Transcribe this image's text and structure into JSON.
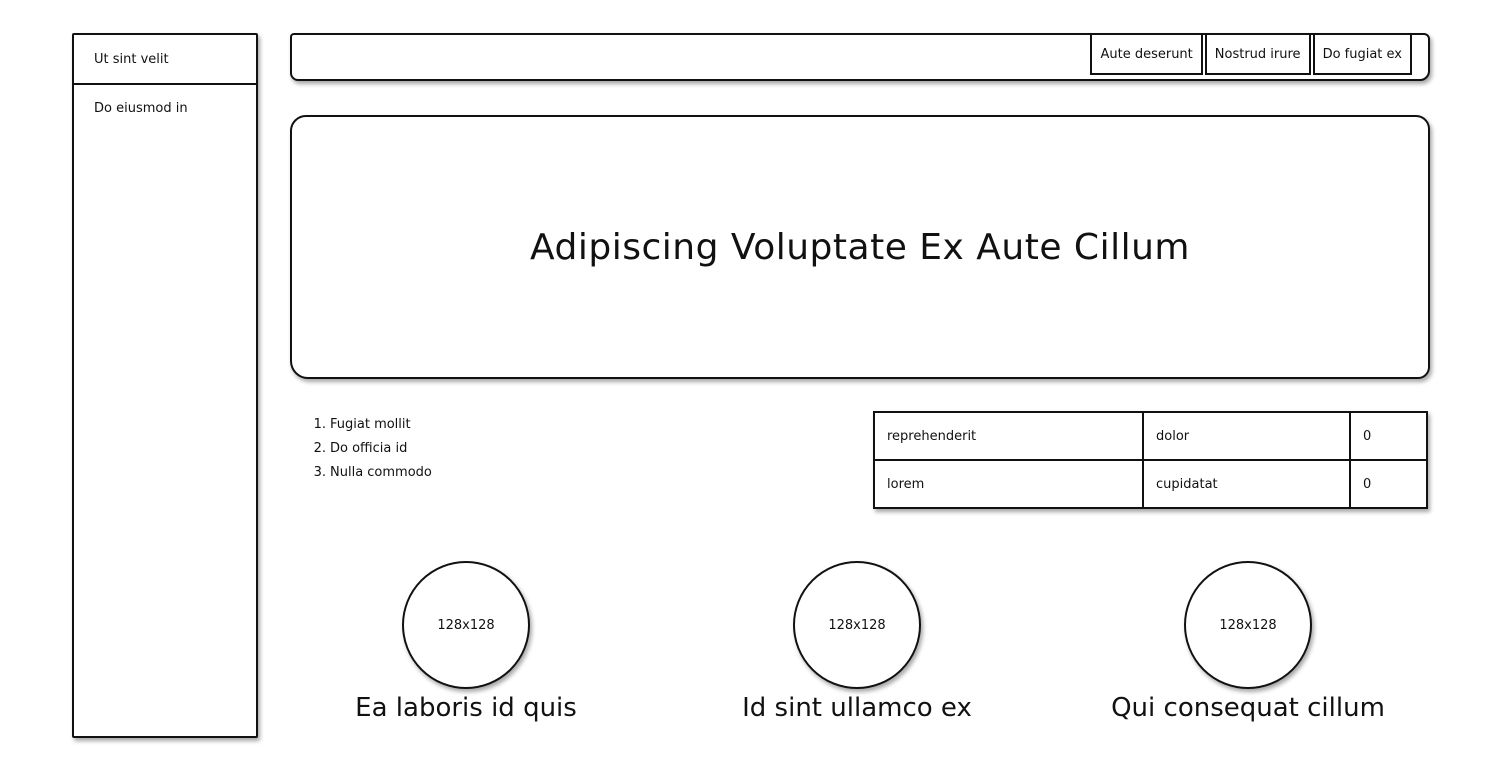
{
  "sidebar": {
    "header": "Ut sint velit",
    "items": [
      {
        "label": "Do eiusmod in"
      }
    ]
  },
  "topbar": {
    "tabs": [
      {
        "label": "Aute deserunt"
      },
      {
        "label": "Nostrud irure"
      },
      {
        "label": "Do fugiat ex"
      }
    ]
  },
  "hero": {
    "title": "Adipiscing Voluptate Ex Aute Cillum"
  },
  "list": {
    "items": [
      {
        "num": "1.",
        "label": "Fugiat mollit"
      },
      {
        "num": "2.",
        "label": "Do officia id"
      },
      {
        "num": "3.",
        "label": "Nulla commodo"
      }
    ]
  },
  "table": {
    "rows": [
      [
        "reprehenderit",
        "dolor",
        "0"
      ],
      [
        "lorem",
        "cupidatat",
        "0"
      ]
    ]
  },
  "cards": [
    {
      "image_label": "128x128",
      "caption": "Ea laboris id quis"
    },
    {
      "image_label": "128x128",
      "caption": "Id sint ullamco ex"
    },
    {
      "image_label": "128x128",
      "caption": "Qui consequat cillum"
    }
  ]
}
